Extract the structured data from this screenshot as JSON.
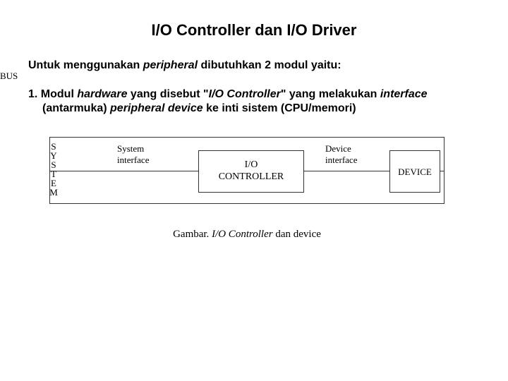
{
  "title": "I/O Controller dan I/O Driver",
  "intro": {
    "pre": "Untuk menggunakan ",
    "em": "peripheral",
    "post": " dibutuhkan 2 modul yaitu:"
  },
  "item1": {
    "num": "1.  ",
    "t1": "Modul ",
    "em1": "hardware",
    "t2": " yang disebut \"",
    "em2": "I/O Controller",
    "t3": "\" yang melakukan ",
    "em3": "interface",
    "t4": " (antarmuka) ",
    "em4": "peripheral device",
    "t5": " ke inti sistem (CPU/memori)"
  },
  "diagram": {
    "system_letters": [
      "S",
      "Y",
      "S",
      "T",
      "E",
      "M"
    ],
    "bus": "BUS",
    "sys_int": "System\ninterface",
    "dev_int": "Device\ninterface",
    "controller_l1": "I/O",
    "controller_l2": "CONTROLLER",
    "device": "DEVICE"
  },
  "caption": {
    "pre": "Gambar.  ",
    "em": "I/O Controller",
    "post": " dan device"
  }
}
